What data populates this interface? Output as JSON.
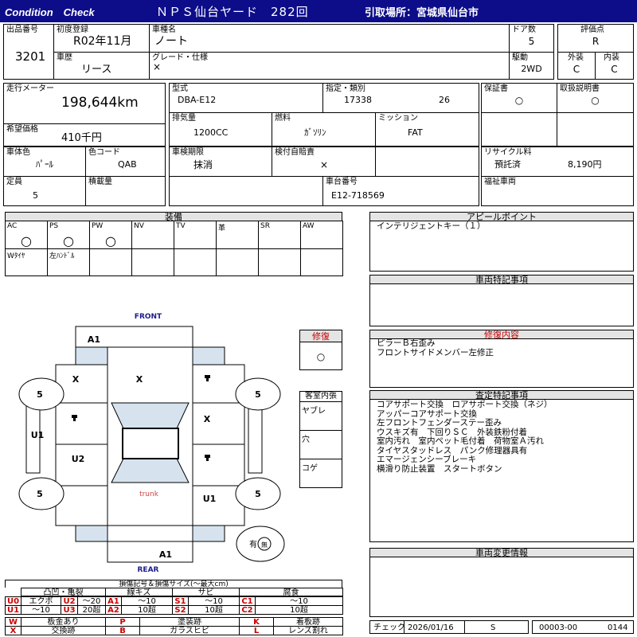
{
  "header": {
    "condition_check": "Condition　Check",
    "title": "ＮＰＳ仙台ヤード　282回",
    "pickup": "引取場所：宮城県仙台市"
  },
  "lot": {
    "label": "出品番号",
    "value": "3201"
  },
  "first_reg": {
    "label": "初度登録",
    "value": "R02年11月"
  },
  "car_name": {
    "label": "車種名",
    "value": "ノート"
  },
  "doors": {
    "label": "ドア数",
    "value": "5"
  },
  "rating": {
    "label": "評価点",
    "value": "R"
  },
  "history": {
    "label": "車歴",
    "value": "リース"
  },
  "grade": {
    "label": "グレード・仕様",
    "value": "×"
  },
  "drive": {
    "label": "駆動",
    "value": "2WD"
  },
  "exterior": {
    "label": "外装",
    "value": "C"
  },
  "interior": {
    "label": "内装",
    "value": "C"
  },
  "mileage": {
    "label": "走行メーター",
    "value": "198,644km"
  },
  "desired": {
    "label": "希望価格",
    "value": "410千円"
  },
  "model": {
    "label": "型式",
    "value": "DBA-E12"
  },
  "designation": {
    "label": "指定・類別",
    "value1": "17338",
    "value2": "26"
  },
  "warranty": {
    "label": "保証書",
    "value": "○"
  },
  "manual": {
    "label": "取扱説明書",
    "value": "○"
  },
  "displacement": {
    "label": "排気量",
    "value": "1200CC"
  },
  "fuel": {
    "label": "燃料",
    "value": "ｶﾞｿﾘﾝ"
  },
  "mission": {
    "label": "ミッション",
    "value": "FAT"
  },
  "body_color": {
    "label": "車体色",
    "value": "ﾊﾟｰﾙ"
  },
  "color_code": {
    "label": "色コード",
    "value": "QAB"
  },
  "inspection": {
    "label": "車検期限",
    "value": "抹消"
  },
  "liability": {
    "label": "検付自賠責",
    "value": "×"
  },
  "recycle": {
    "label": "リサイクル料",
    "value1": "預託済",
    "value2": "8,190円"
  },
  "capacity": {
    "label": "定員",
    "value": "5"
  },
  "load": {
    "label": "積載量",
    "value": ""
  },
  "chassis": {
    "label": "車台番号",
    "value": "E12-718569"
  },
  "welfare": {
    "label": "福祉車両",
    "value": ""
  },
  "equipment": {
    "title": "装備",
    "row1": [
      {
        "label": "AC",
        "value": "○"
      },
      {
        "label": "PS",
        "value": "○"
      },
      {
        "label": "PW",
        "value": "○"
      },
      {
        "label": "NV",
        "value": ""
      },
      {
        "label": "TV",
        "value": ""
      },
      {
        "label": "革",
        "value": ""
      },
      {
        "label": "SR",
        "value": ""
      },
      {
        "label": "AW",
        "value": ""
      }
    ],
    "row2": [
      {
        "label": "Wﾀｲﾔ",
        "value": ""
      },
      {
        "label": "左ﾊﾝﾄﾞﾙ",
        "value": ""
      },
      {
        "label": "",
        "value": ""
      },
      {
        "label": "",
        "value": ""
      },
      {
        "label": "",
        "value": ""
      },
      {
        "label": "",
        "value": ""
      },
      {
        "label": "",
        "value": ""
      },
      {
        "label": "",
        "value": ""
      }
    ]
  },
  "appeal": {
    "title": "アピールポイント",
    "lines": [
      "インテリジェントキー（１）"
    ]
  },
  "special": {
    "title": "車両特記事項"
  },
  "repair_content": {
    "title": "修復内容",
    "lines": [
      "ピラーＢ右歪み",
      "フロントサイドメンバー左修正"
    ]
  },
  "inspector": {
    "title": "査定特記事項",
    "lines": [
      "コアサポート交換　ロアサポート交換（ネジ）",
      "アッパーコアサポート交換",
      "左フロントフェンダーステー歪み",
      "ウスキズ有　下回りＳＣ　外装鉄粉付着",
      "室内汚れ　室内ペット毛付着　荷物室Ａ汚れ",
      "タイヤスタッドレス　パンク修理器具有",
      "エマージェンシーブレーキ",
      "横滑り防止装置　スタートボタン"
    ]
  },
  "change": {
    "title": "車両変更情報"
  },
  "repair": {
    "label": "修復",
    "value": "○"
  },
  "interior_state": {
    "title": "客室内張",
    "items": [
      "ヤブレ",
      "穴",
      "コゲ"
    ]
  },
  "diagram": {
    "front": "FRONT",
    "rear": "REAR",
    "trunk": "trunk",
    "ari": "有",
    "none": "無",
    "marks": {
      "a1_top": "A1",
      "a1_bottom": "A1",
      "x_left": "X",
      "x_center": "X",
      "x_right": "X",
      "u2": "U2",
      "u1_side": "U1",
      "u1_rear": "U1",
      "tire": "5"
    }
  },
  "legend": {
    "title": "損傷記号＆損傷サイズ(〜最大cm)",
    "groups": [
      "凸凹・亀裂",
      "線キズ",
      "サビ",
      "腐食"
    ],
    "rows": [
      [
        [
          "U0",
          "エクボ"
        ],
        [
          "U2",
          "〜20"
        ],
        [
          "A1",
          "〜10"
        ],
        [
          "S1",
          "〜10"
        ],
        [
          "C1",
          "〜10"
        ]
      ],
      [
        [
          "U1",
          "〜10"
        ],
        [
          "U3",
          "20超"
        ],
        [
          "A2",
          "10超"
        ],
        [
          "S2",
          "10超"
        ],
        [
          "C2",
          "10超"
        ]
      ]
    ],
    "rows2": [
      [
        [
          "W",
          "板金あり"
        ],
        [
          "P",
          "塗装跡"
        ],
        [
          "K",
          "着板跡"
        ]
      ],
      [
        [
          "X",
          "交換跡"
        ],
        [
          "B",
          "ガラスヒビ"
        ],
        [
          "L",
          "レンズ割れ"
        ]
      ]
    ]
  },
  "footer": {
    "check": "チェック",
    "date": "2026/01/16",
    "code": "S",
    "num1": "00003-00",
    "num2": "0144"
  }
}
